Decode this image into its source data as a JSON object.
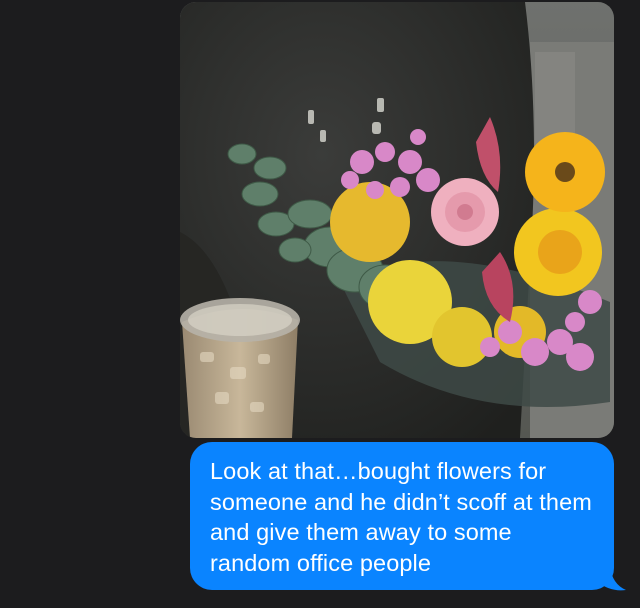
{
  "conversation": {
    "messages": [
      {
        "type": "photo",
        "direction": "outgoing",
        "alt": "",
        "icon": "flower-bouquet-photo"
      },
      {
        "type": "text",
        "direction": "outgoing",
        "text": "Look at that…bought flowers for someone and he didn’t scoff at them and give them away to some random office people"
      }
    ]
  },
  "colors": {
    "background": "#1c1c1e",
    "outgoing_bubble": "#0a84ff",
    "bubble_text": "#ffffff"
  }
}
